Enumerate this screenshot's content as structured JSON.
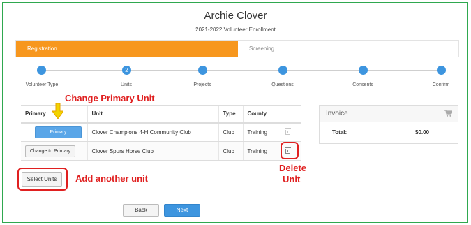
{
  "header": {
    "title": "Archie Clover",
    "subtitle": "2021-2022 Volunteer Enrollment"
  },
  "tabs": [
    {
      "label": "Registration",
      "active": true
    },
    {
      "label": "Screening",
      "active": false
    }
  ],
  "steps": [
    {
      "label": "Volunteer Type",
      "number": ""
    },
    {
      "label": "Units",
      "number": "2"
    },
    {
      "label": "Projects",
      "number": ""
    },
    {
      "label": "Questions",
      "number": ""
    },
    {
      "label": "Consents",
      "number": ""
    },
    {
      "label": "Confirm",
      "number": ""
    }
  ],
  "annotations": {
    "change_primary": "Change Primary Unit",
    "add_unit": "Add another unit",
    "delete": "Delete",
    "delete_unit": "Unit"
  },
  "units_table": {
    "headers": [
      "Primary",
      "Unit",
      "Type",
      "County",
      ""
    ],
    "rows": [
      {
        "primary_button": "Primary",
        "unit": "Clover Champions 4-H Community Club",
        "type": "Club",
        "county": "Training"
      },
      {
        "primary_button": "Change to Primary",
        "unit": "Clover Spurs Horse Club",
        "type": "Club",
        "county": "Training"
      }
    ]
  },
  "invoice": {
    "title": "Invoice",
    "total_label": "Total:",
    "total_value": "$0.00"
  },
  "actions": {
    "select_units": "Select Units",
    "back": "Back",
    "next": "Next"
  },
  "colors": {
    "accent_blue": "#3d95df",
    "orange": "#f7971e",
    "annotation_red": "#e02020",
    "frame_green": "#2fa84f"
  }
}
